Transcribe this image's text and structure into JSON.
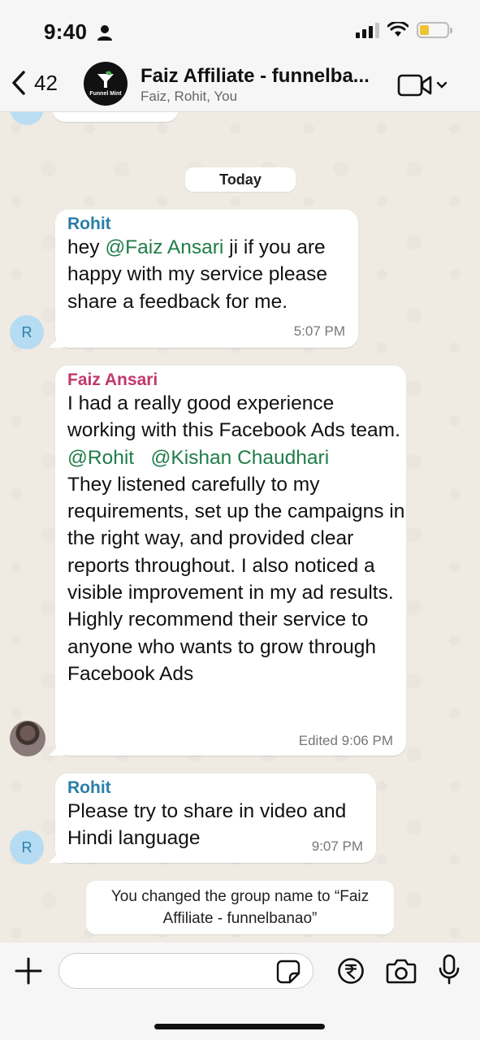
{
  "status_bar": {
    "time": "9:40"
  },
  "header": {
    "back_count": "42",
    "avatar_text": "Funnel Mint",
    "title": "Faiz Affiliate - funnelba...",
    "members": "Faiz, Rohit, You"
  },
  "chat": {
    "date_label": "Today",
    "messages": [
      {
        "sender": "Rohit",
        "parts": [
          "hey ",
          "@Faiz Ansari",
          " ji if you are happy with my service please share a feedback for me."
        ],
        "time": "5:07 PM",
        "avatar_initial": "R"
      },
      {
        "sender": "Faiz Ansari",
        "parts": [
          "I had a really good experience working with this Facebook Ads team. ",
          "@Rohit",
          "   ",
          "@Kishan Chaudhari",
          "They listened carefully to my requirements, set up the campaigns in the right way, and provided clear reports throughout. I also noticed a visible improvement in my ad results. Highly recommend their service to anyone who wants to grow through Facebook Ads"
        ],
        "time": "Edited 9:06 PM"
      },
      {
        "sender": "Rohit",
        "parts": [
          "Please try to share in video and Hindi language"
        ],
        "time": "9:07 PM",
        "avatar_initial": "R"
      }
    ],
    "system_message": "You changed the group name to “Faiz Affiliate - funnelbanao”"
  },
  "input": {
    "value": "",
    "placeholder": ""
  },
  "icons": {
    "back": "chevron-left-icon",
    "video": "video-camera-icon",
    "plus": "plus-icon",
    "sticker": "sticker-icon",
    "rupee": "rupee-payment-icon",
    "camera": "camera-icon",
    "mic": "microphone-icon"
  },
  "colors": {
    "sender_rohit": "#2b7ea8",
    "sender_faiz": "#c2386a",
    "mention": "#1f7d49",
    "chat_background": "#efeae2",
    "battery_level": "#f1c232"
  }
}
